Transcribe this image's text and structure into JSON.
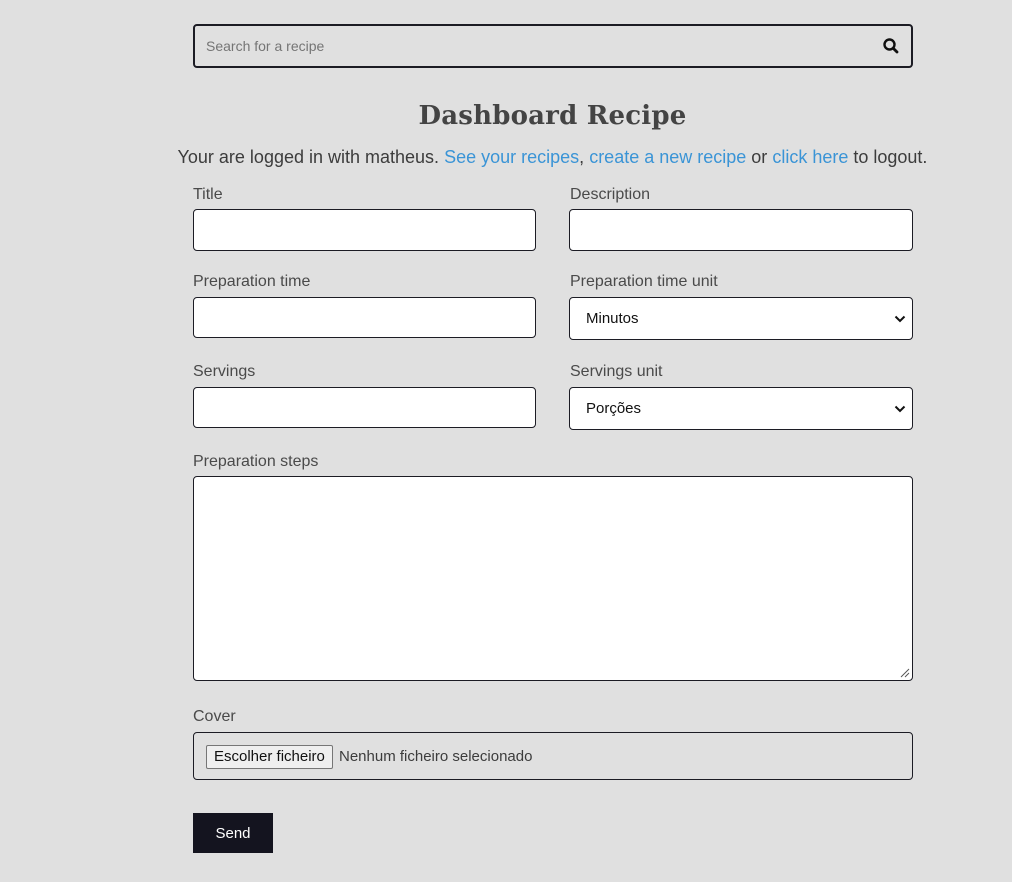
{
  "search": {
    "placeholder": "Search for a recipe",
    "icon": "search-icon"
  },
  "header": {
    "title": "Dashboard Recipe",
    "login_prefix": "Your are logged in with matheus.",
    "link_see_recipes": "See your recipes",
    "comma": ",",
    "link_new_recipe": "create a new recipe",
    "or_text": "or",
    "link_logout": "click here",
    "logout_suffix": "to logout."
  },
  "form": {
    "title": {
      "label": "Title",
      "value": ""
    },
    "description": {
      "label": "Description",
      "value": ""
    },
    "preparation_time": {
      "label": "Preparation time",
      "value": ""
    },
    "preparation_time_unit": {
      "label": "Preparation time unit",
      "selected": "Minutos"
    },
    "servings": {
      "label": "Servings",
      "value": ""
    },
    "servings_unit": {
      "label": "Servings unit",
      "selected": "Porções"
    },
    "preparation_steps": {
      "label": "Preparation steps",
      "value": ""
    },
    "cover": {
      "label": "Cover",
      "button_label": "Escolher ficheiro",
      "status": "Nenhum ficheiro selecionado"
    },
    "submit_label": "Send"
  },
  "colors": {
    "background": "#e0e0e0",
    "link": "#3a94d6",
    "button_dark": "#14141f",
    "border": "#1c1c24"
  }
}
